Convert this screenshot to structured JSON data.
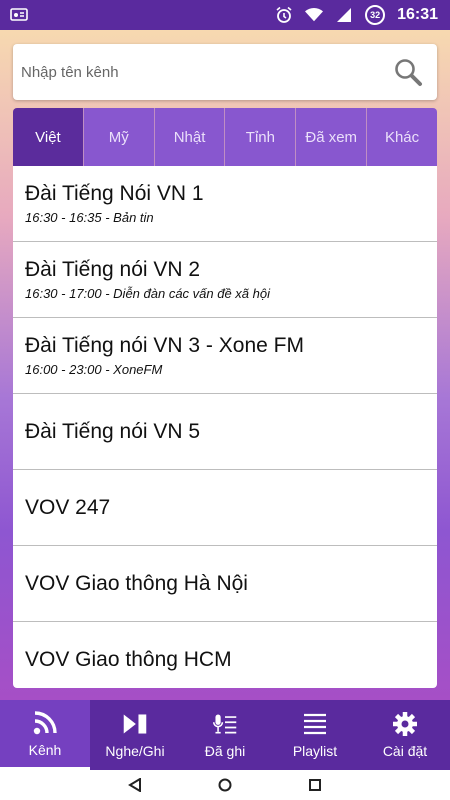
{
  "status_bar": {
    "time": "16:31",
    "battery_level": "32",
    "icons": [
      "cast-icon",
      "alarm-icon",
      "wifi-icon",
      "signal-icon",
      "battery-icon"
    ]
  },
  "search": {
    "placeholder": "Nhập tên kênh",
    "value": ""
  },
  "tabs": [
    {
      "label": "Việt",
      "active": true
    },
    {
      "label": "Mỹ",
      "active": false
    },
    {
      "label": "Nhật",
      "active": false
    },
    {
      "label": "Tỉnh",
      "active": false
    },
    {
      "label": "Đã xem",
      "active": false
    },
    {
      "label": "Khác",
      "active": false
    }
  ],
  "channels": [
    {
      "name": "Đài Tiếng Nói VN 1",
      "program": "16:30 - 16:35 - Bản tin"
    },
    {
      "name": "Đài Tiếng nói VN 2",
      "program": "16:30 - 17:00 - Diễn đàn các vấn đề xã hội"
    },
    {
      "name": "Đài Tiếng nói VN 3 - Xone FM",
      "program": "16:00 - 23:00 - XoneFM"
    },
    {
      "name": "Đài Tiếng nói VN 5",
      "program": ""
    },
    {
      "name": "VOV 247",
      "program": ""
    },
    {
      "name": "VOV Giao thông Hà Nội",
      "program": ""
    },
    {
      "name": "VOV Giao thông HCM",
      "program": ""
    }
  ],
  "bottom_nav": [
    {
      "label": "Kênh",
      "icon": "rss-icon",
      "active": true
    },
    {
      "label": "Nghe/Ghi",
      "icon": "play-record-icon",
      "active": false
    },
    {
      "label": "Đã ghi",
      "icon": "recorded-icon",
      "active": false
    },
    {
      "label": "Playlist",
      "icon": "playlist-icon",
      "active": false
    },
    {
      "label": "Cài đặt",
      "icon": "gear-icon",
      "active": false
    }
  ],
  "colors": {
    "primary": "#5a2a9e",
    "tab": "#8857cf",
    "tab_active": "#5b2c9c"
  }
}
